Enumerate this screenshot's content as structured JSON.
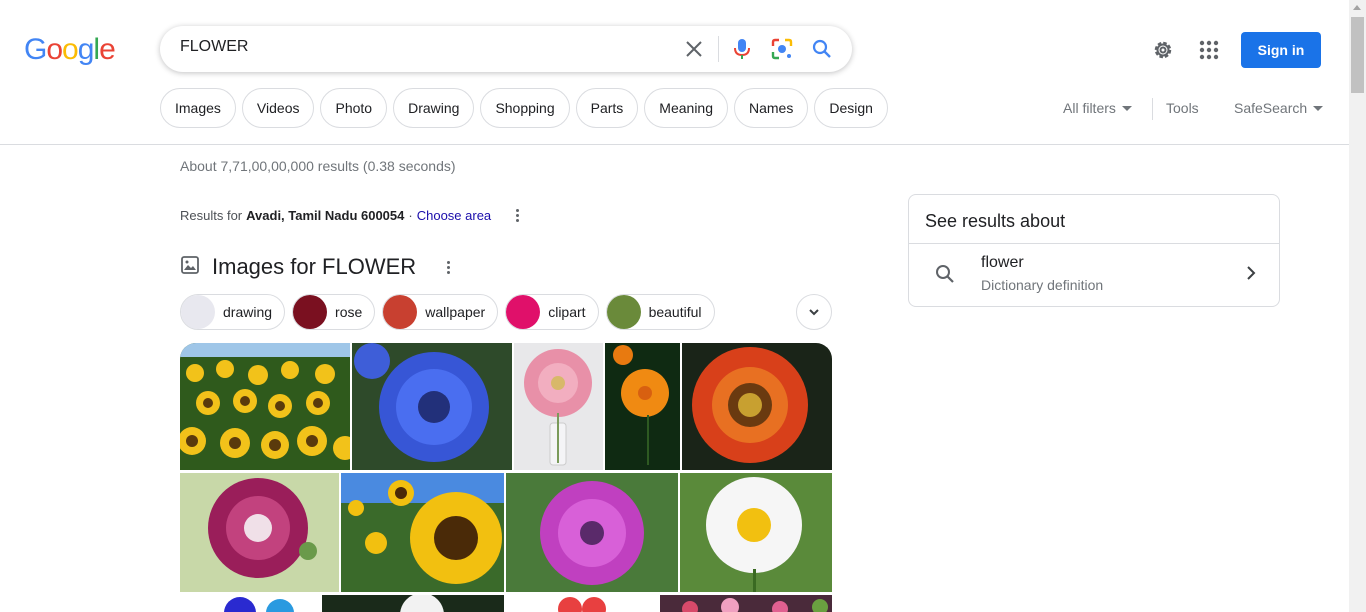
{
  "logo": {
    "letters": [
      "G",
      "o",
      "o",
      "g",
      "l",
      "e"
    ],
    "colors": [
      "#4285F4",
      "#EA4335",
      "#FBBC05",
      "#4285F4",
      "#34A853",
      "#EA4335"
    ]
  },
  "search": {
    "value": "FLOWER",
    "placeholder": ""
  },
  "icons": {
    "clear": "close-icon",
    "voice": "mic-icon",
    "lens": "lens-icon",
    "search": "search-icon",
    "settings": "gear-icon",
    "apps": "apps-grid-icon"
  },
  "header": {
    "signin_label": "Sign in",
    "signin_color": "#1a73e8"
  },
  "filters": [
    "Images",
    "Videos",
    "Photo",
    "Drawing",
    "Shopping",
    "Parts",
    "Meaning",
    "Names",
    "Design"
  ],
  "tools": {
    "all_filters": "All filters",
    "tools": "Tools",
    "safesearch": "SafeSearch"
  },
  "results": {
    "stats": "About 7,71,00,00,000 results (0.38 seconds)",
    "location_prefix": "Results for",
    "location": "Avadi, Tamil Nadu 600054",
    "separator": "·",
    "choose_area": "Choose area"
  },
  "images_section": {
    "heading": "Images for FLOWER",
    "suggestions": [
      {
        "label": "drawing",
        "thumb": "#e8e8ef"
      },
      {
        "label": "rose",
        "thumb": "#7a1020"
      },
      {
        "label": "wallpaper",
        "thumb": "#c84030"
      },
      {
        "label": "clipart",
        "thumb": "#e0106a"
      },
      {
        "label": "beautiful",
        "thumb": "#6a8a3a"
      }
    ]
  },
  "side_panel": {
    "title": "See results about",
    "item_word": "flower",
    "item_sub": "Dictionary definition"
  }
}
